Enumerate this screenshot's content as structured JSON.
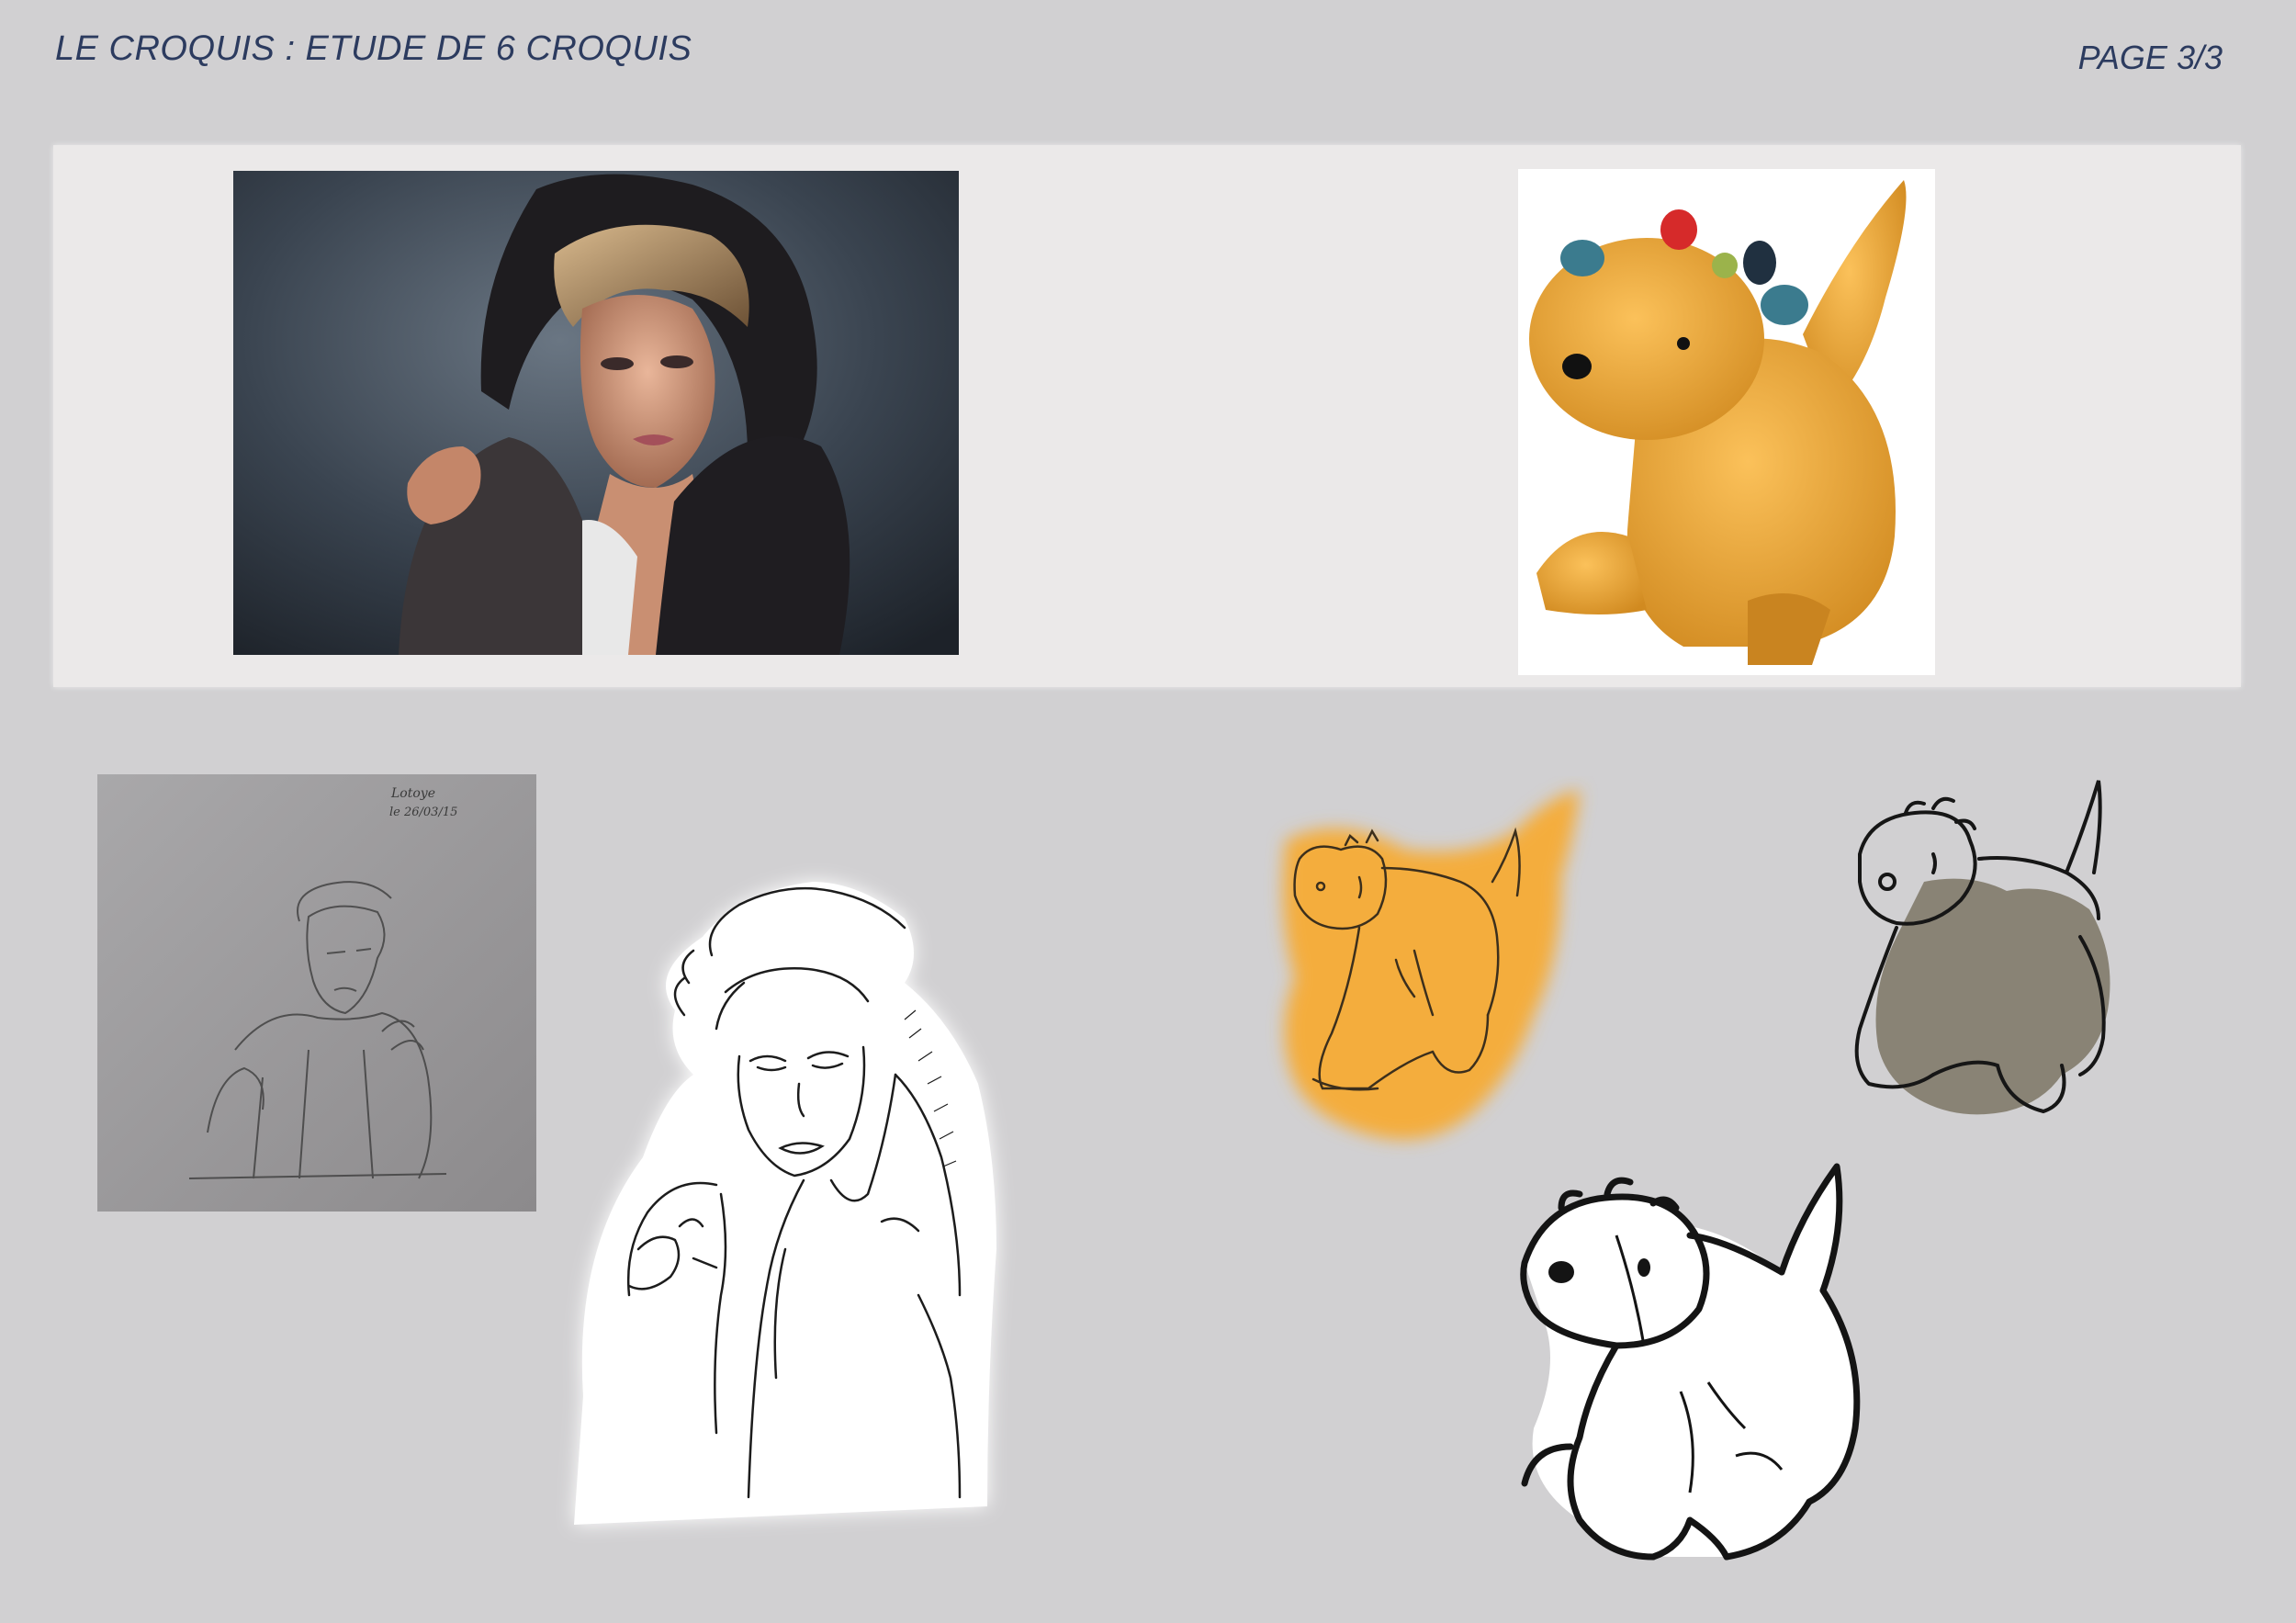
{
  "header": {
    "title": "LE CROQUIS : ETUDE DE 6 CROQUIS",
    "page": "PAGE 3/3"
  },
  "colors": {
    "background": "#d1d0d2",
    "reference_band": "#ebe9e9",
    "header_text": "#2c3b5f",
    "toy_orange": "#f2ac3a"
  },
  "images": {
    "reference_photo": "portrait-photo-woman-fur-hood",
    "reference_toy": "yellow-plush-dinosaur-photo",
    "sketch_1": "pencil-sketch-on-paper",
    "sketch_2": "digital-line-drawing-woman",
    "sketch_3": "orange-dinosaur-sketch",
    "sketch_4": "gray-dinosaur-sketch",
    "sketch_5": "black-white-dinosaur-sketch"
  },
  "paper_note": {
    "line1": "Lotoye",
    "line2": "le 26/03/15"
  }
}
